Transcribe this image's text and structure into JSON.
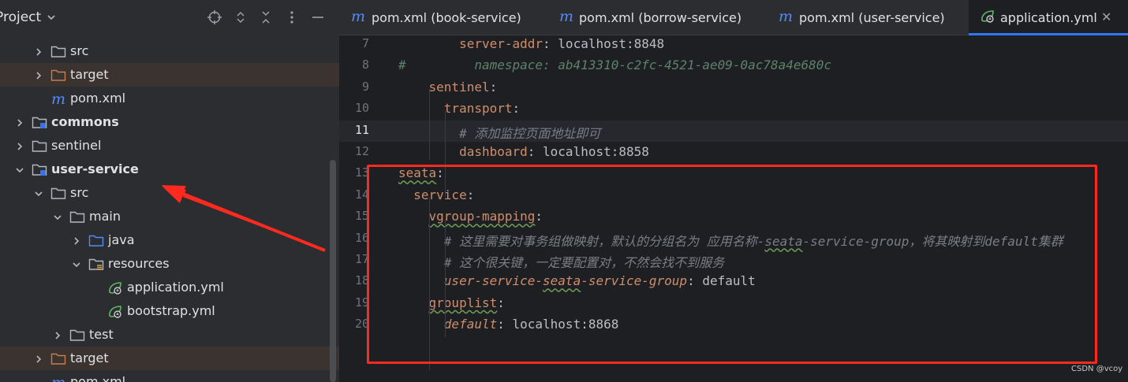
{
  "project_panel": {
    "title": "Project",
    "tree": [
      {
        "label": "src",
        "icon": "folder-icon",
        "expanded": false,
        "bold": false
      },
      {
        "label": "target",
        "icon": "folder-excluded-icon",
        "expanded": false,
        "bold": false
      },
      {
        "label": "pom.xml",
        "icon": "maven-icon",
        "expanded": null,
        "bold": false
      },
      {
        "label": "commons",
        "icon": "module-folder-icon",
        "expanded": false,
        "bold": true
      },
      {
        "label": "sentinel",
        "icon": "folder-icon",
        "expanded": false,
        "bold": false
      },
      {
        "label": "user-service",
        "icon": "module-folder-icon",
        "expanded": true,
        "bold": true
      },
      {
        "label": "src",
        "icon": "folder-icon",
        "expanded": true,
        "bold": false
      },
      {
        "label": "main",
        "icon": "folder-icon",
        "expanded": true,
        "bold": false
      },
      {
        "label": "java",
        "icon": "source-folder-icon",
        "expanded": false,
        "bold": false
      },
      {
        "label": "resources",
        "icon": "resources-folder-icon",
        "expanded": true,
        "bold": false
      },
      {
        "label": "application.yml",
        "icon": "spring-yaml-icon",
        "expanded": null,
        "bold": false
      },
      {
        "label": "bootstrap.yml",
        "icon": "spring-yaml-icon",
        "expanded": null,
        "bold": false
      },
      {
        "label": "test",
        "icon": "folder-icon",
        "expanded": false,
        "bold": false
      },
      {
        "label": "target",
        "icon": "folder-excluded-icon",
        "expanded": false,
        "bold": false
      },
      {
        "label": "pom.xml",
        "icon": "maven-icon",
        "expanded": null,
        "bold": false
      }
    ]
  },
  "tabs": [
    {
      "label": "pom.xml (book-service)",
      "icon": "maven-icon",
      "active": false
    },
    {
      "label": "pom.xml (borrow-service)",
      "icon": "maven-icon",
      "active": false
    },
    {
      "label": "pom.xml (user-service)",
      "icon": "maven-icon",
      "active": false
    },
    {
      "label": "application.yml",
      "icon": "spring-yaml-icon",
      "active": true
    }
  ],
  "editor": {
    "current_line": 11,
    "lines": [
      {
        "n": "7",
        "tokens": [
          {
            "t": "        ",
            "c": "p"
          },
          {
            "t": "server-addr",
            "c": "k"
          },
          {
            "t": ": localhost:8848",
            "c": "v"
          }
        ]
      },
      {
        "n": "8",
        "tokens": [
          {
            "t": "#         namespace: ab413310-c2fc-4521-ae09-0ac78a4e680c",
            "c": "ck"
          }
        ]
      },
      {
        "n": "9",
        "tokens": [
          {
            "t": "    ",
            "c": "p"
          },
          {
            "t": "sentinel",
            "c": "k"
          },
          {
            "t": ":",
            "c": "p"
          }
        ]
      },
      {
        "n": "10",
        "tokens": [
          {
            "t": "      ",
            "c": "p"
          },
          {
            "t": "transport",
            "c": "k"
          },
          {
            "t": ":",
            "c": "p"
          }
        ]
      },
      {
        "n": "11",
        "tokens": [
          {
            "t": "        ",
            "c": "p"
          },
          {
            "t": "# 添加监控页面地址即可",
            "c": "c"
          }
        ]
      },
      {
        "n": "12",
        "tokens": [
          {
            "t": "        ",
            "c": "p"
          },
          {
            "t": "dashboard",
            "c": "k"
          },
          {
            "t": ": localhost:8858",
            "c": "v"
          }
        ]
      },
      {
        "n": "13",
        "tokens": [
          {
            "t": "seata",
            "c": "k wavy"
          },
          {
            "t": ":",
            "c": "p"
          }
        ]
      },
      {
        "n": "14",
        "tokens": [
          {
            "t": "  ",
            "c": "p"
          },
          {
            "t": "service",
            "c": "k"
          },
          {
            "t": ":",
            "c": "p"
          }
        ]
      },
      {
        "n": "15",
        "tokens": [
          {
            "t": "    ",
            "c": "p"
          },
          {
            "t": "vgroup-mapping",
            "c": "k wavy"
          },
          {
            "t": ":",
            "c": "p"
          }
        ]
      },
      {
        "n": "16",
        "tokens": [
          {
            "t": "      ",
            "c": "p"
          },
          {
            "t": "# 这里需要对事务组做映射，默认的分组名为 应用名称-",
            "c": "c"
          },
          {
            "t": "seata",
            "c": "c wavy"
          },
          {
            "t": "-service-group，将其映射到default集群",
            "c": "c"
          }
        ]
      },
      {
        "n": "17",
        "tokens": [
          {
            "t": "      ",
            "c": "p"
          },
          {
            "t": "# 这个很关键，一定要配置对，不然会找不到服务",
            "c": "c"
          }
        ]
      },
      {
        "n": "18",
        "tokens": [
          {
            "t": "      ",
            "c": "p"
          },
          {
            "t": "user-service-",
            "c": "ki"
          },
          {
            "t": "seata",
            "c": "ki wavy"
          },
          {
            "t": "-service-group",
            "c": "ki"
          },
          {
            "t": ": default",
            "c": "v"
          }
        ]
      },
      {
        "n": "19",
        "tokens": [
          {
            "t": "    ",
            "c": "p"
          },
          {
            "t": "grouplist",
            "c": "k wavy"
          },
          {
            "t": ":",
            "c": "p"
          }
        ]
      },
      {
        "n": "20",
        "tokens": [
          {
            "t": "      ",
            "c": "p"
          },
          {
            "t": "default",
            "c": "ki"
          },
          {
            "t": ": localhost:8868",
            "c": "v"
          }
        ]
      }
    ]
  },
  "watermark": "CSDN @vcoy",
  "colors": {
    "annotation": "#ff2a1f",
    "accent": "#3574f0"
  }
}
